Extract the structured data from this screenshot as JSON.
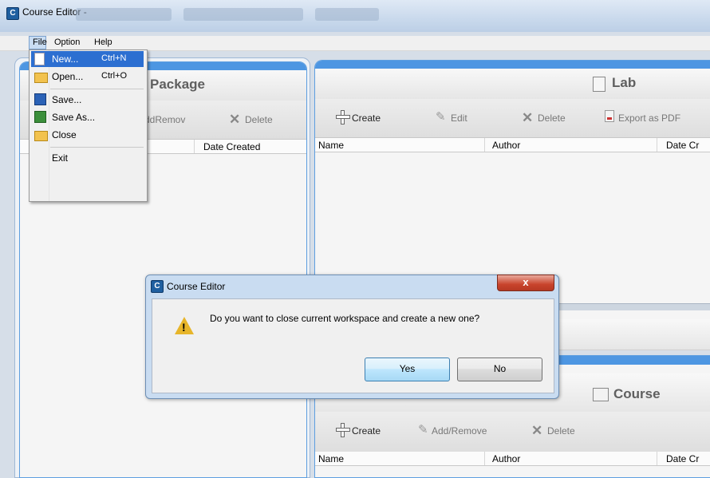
{
  "window": {
    "title": "Course Editor -"
  },
  "menubar": {
    "items": [
      "File",
      "Option",
      "Help"
    ]
  },
  "file_menu": {
    "items": [
      {
        "label": "New...",
        "shortcut": "Ctrl+N",
        "icon": "new-document-icon",
        "highlighted": true
      },
      {
        "label": "Open...",
        "shortcut": "Ctrl+O",
        "icon": "open-folder-icon"
      },
      {
        "label": "Save...",
        "shortcut": "",
        "icon": "save-disk-icon"
      },
      {
        "label": "Save As...",
        "shortcut": "",
        "icon": "save-as-icon"
      },
      {
        "label": "Close",
        "shortcut": "",
        "icon": "close-folder-icon"
      },
      {
        "label": "Exit",
        "shortcut": "",
        "icon": ""
      }
    ]
  },
  "package_panel": {
    "title": "Package",
    "toolbar": {
      "add_remove": "ddRemov",
      "delete": "Delete"
    },
    "columns": [
      "Date Created"
    ]
  },
  "lab_panel": {
    "title": "Lab",
    "toolbar": {
      "create": "Create",
      "edit": "Edit",
      "delete": "Delete",
      "export": "Export as PDF"
    },
    "columns": [
      "Name",
      "Author",
      "Date Cr"
    ]
  },
  "course_panel": {
    "title": "Course",
    "toolbar": {
      "create": "Create",
      "add_remove": "Add/Remove",
      "delete": "Delete"
    },
    "columns": [
      "Name",
      "Author",
      "Date Cr"
    ]
  },
  "dialog": {
    "title": "Course Editor",
    "close": "x",
    "message": "Do you want to close current workspace and create a new one?",
    "yes": "Yes",
    "no": "No"
  },
  "colors": {
    "accent": "#4d96e2",
    "menu_highlight": "#2c6fd1",
    "warning": "#e7b52a",
    "close_button": "#c8442c"
  }
}
